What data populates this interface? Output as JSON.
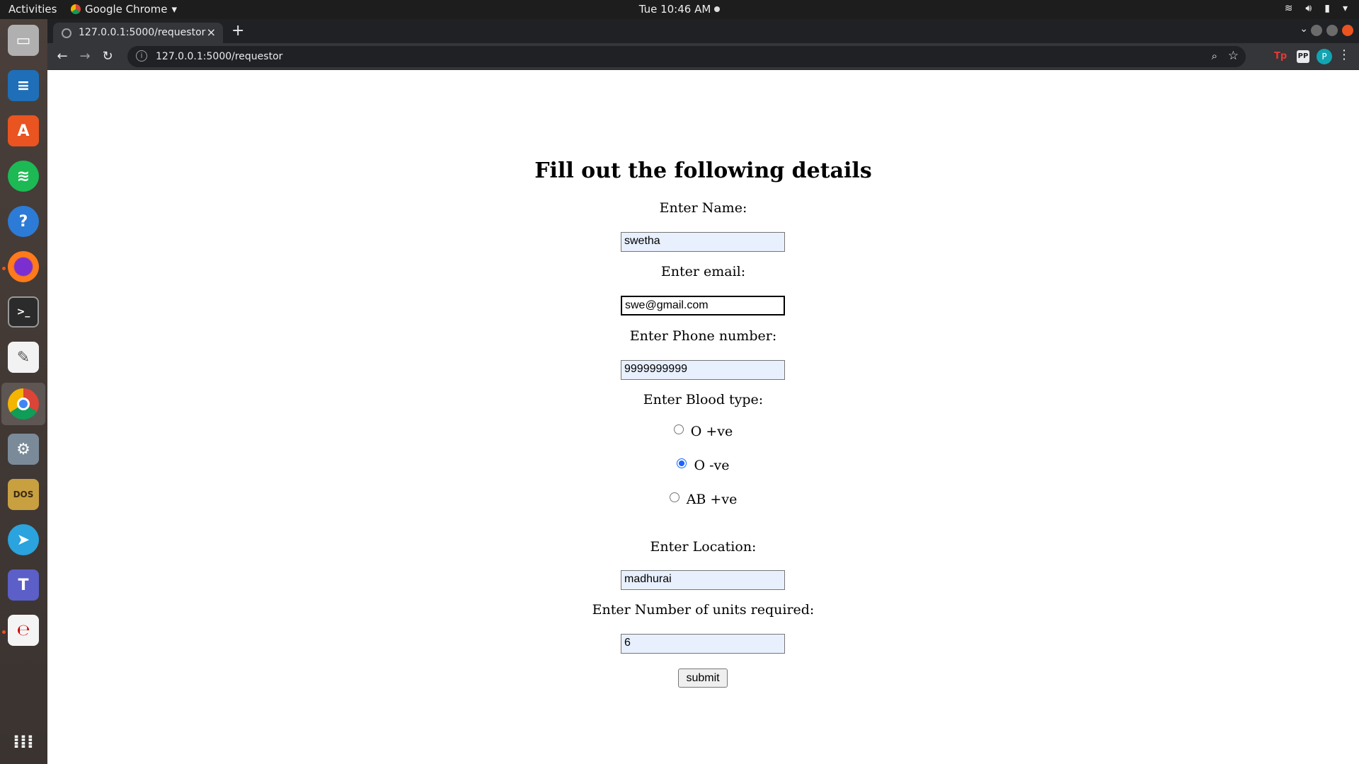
{
  "topbar": {
    "activities": "Activities",
    "app_name": "Google Chrome",
    "clock": "Tue 10:46 AM"
  },
  "browser": {
    "tab_title": "127.0.0.1:5000/requestor",
    "url": "127.0.0.1:5000/requestor",
    "profile_initial": "P",
    "extensions": [
      "Tp",
      "PP"
    ]
  },
  "dock": {
    "items": [
      "files-icon",
      "writer-icon",
      "software-center-icon",
      "spotify-icon",
      "help-icon",
      "firefox-icon",
      "terminal-icon",
      "text-editor-icon",
      "chrome-icon",
      "settings-icon",
      "dosbox-icon",
      "telegram-icon",
      "teams-icon",
      "evince-icon",
      "app-grid-icon"
    ]
  },
  "form": {
    "heading": "Fill out the following details",
    "name_label": "Enter Name:",
    "name_value": "swetha",
    "email_label": "Enter email:",
    "email_value": "swe@gmail.com",
    "phone_label": "Enter Phone number:",
    "phone_value": "9999999999",
    "blood_label": "Enter Blood type:",
    "blood_options": [
      "O +ve",
      "O -ve",
      "AB +ve"
    ],
    "blood_selected": "O -ve",
    "location_label": "Enter Location:",
    "location_value": "madhurai",
    "units_label": "Enter Number of units required:",
    "units_value": "6",
    "submit_label": "submit"
  }
}
